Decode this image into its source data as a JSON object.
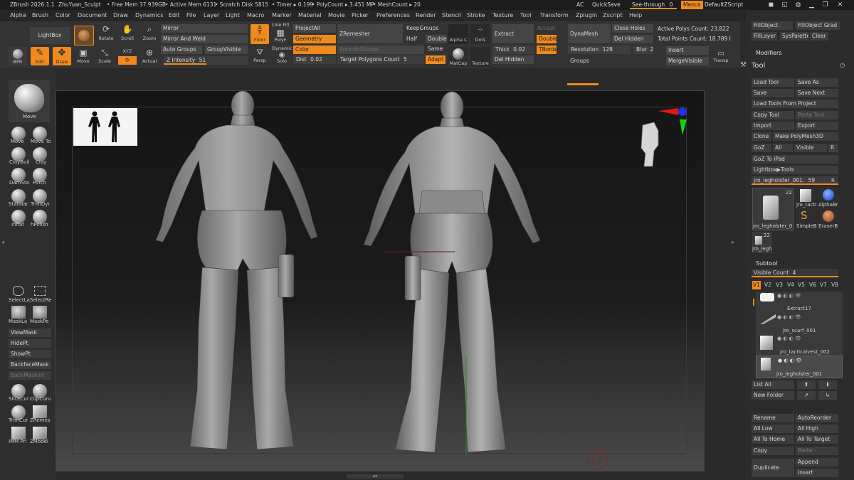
{
  "titlebar": {
    "app": "ZBrush 2026.1.1",
    "project": "ZhuYuan_Sculpt",
    "free_mem": "• Free Mem 37.939GB",
    "active_mem": "• Active Mem 6131",
    "scratch": "• Scratch Disk 5815",
    "timer": "• Timer ▸ 0.199",
    "polycount": "• PolyCount ▸ 3.451 MP",
    "meshcount": "• MeshCount ▸ 20",
    "ac": "AC",
    "quicksave": "QuickSave",
    "see_through": "See-through",
    "see_through_val": "0",
    "menus": "Menus",
    "script": "DefaultZScript"
  },
  "menus": [
    "Alpha",
    "Brush",
    "Color",
    "Document",
    "Draw",
    "Dynamics",
    "Edit",
    "File",
    "Layer",
    "Light",
    "Macro",
    "Marker",
    "Material",
    "Movie",
    "Picker",
    "Preferences",
    "Render",
    "Stencil",
    "Stroke",
    "Texture",
    "Tool",
    "Transform",
    "Zplugin",
    "Zscript",
    "Help"
  ],
  "toolbar": {
    "lightbox": "LightBox",
    "rotate": "Rotate",
    "scroll": "Scroll",
    "zoom": "Zoom",
    "bpr": "BPR",
    "edit": "Edit",
    "draw": "Draw",
    "move": "Move",
    "scale": "Scale",
    "xyz": "XYZ",
    "actual": "Actual",
    "mirror": "Mirror",
    "mirror_weld": "Mirror And Weld",
    "auto_groups": "Auto Groups",
    "group_visible": "GroupVisible",
    "z_intensity": "Z Intensity",
    "z_intensity_val": "51",
    "z_intensity_frac": 0.51,
    "floor": "Floor",
    "line_fill": "Line Fill",
    "polyf": "PolyF",
    "persp": "Persp",
    "dynamic": "Dynamic",
    "solo": "Solo",
    "projectall": "ProjectAll",
    "geometry": "Geometry",
    "color": "Color",
    "dist": "Dist",
    "dist_val": "0.02",
    "zremesher": "ZRemesher",
    "smoothgroups": "SmoothGroups",
    "target_polygons": "Target Polygons Count",
    "target_polygons_val": "5",
    "keepgroups": "KeepGroups",
    "half": "Half",
    "same": "Same",
    "adapt": "Adapt",
    "double": "Double",
    "alpha_c": "Alpha C",
    "matcap": "MatCap",
    "dots": "Dots",
    "texture": "Texture",
    "extract": "Extract",
    "thick": "Thick",
    "thick_val": "0.02",
    "del_hidden": "Del Hidden",
    "accept": "Accept",
    "double2": "Double",
    "tborder": "TBorde",
    "dynamesh": "DynaMesh",
    "close_holes": "Close Holes",
    "del_hidden2": "Del Hidden",
    "resolution": "Resolution",
    "resolution_val": "128",
    "blur": "Blur",
    "blur_val": "2",
    "groups": "Groups",
    "active_polys": "Active Polys Count: 23,822",
    "total_points": "Total Points Count: 18.789 I",
    "insert": "Insert",
    "merge_visible": "MergeVisible",
    "transp": "Transp"
  },
  "left": {
    "current_brush": "Move",
    "brushes": [
      "Move",
      "Move To",
      "ClayBuil",
      "Clay",
      "DamSta",
      "Pinch",
      "Standar",
      "TrimDyr",
      "Inflat",
      "hPolish"
    ],
    "select": [
      "SelectLa",
      "SelectRe"
    ],
    "mask": [
      "MaskLa",
      "MaskPe"
    ],
    "buttons": [
      "ViewMask",
      "HidePt",
      "ShowPt",
      "BackfaceMask",
      "BackMaskInt"
    ],
    "tools": [
      "SliceCur",
      "ClipCurv",
      "TrimCur",
      "ZRemes",
      "IMM Pri",
      "ZModel"
    ]
  },
  "right": {
    "fillobject": "FillObject",
    "fillobject_grad": "FillObject Grad",
    "filllayer": "FillLayer",
    "syspalette": "SysPalette",
    "clear": "Clear",
    "modifiers": "Modifiers",
    "tool_title": "Tool",
    "load_tool": "Load Tool",
    "save_as": "Save As",
    "save": "Save",
    "save_next": "Save Next",
    "load_from_project": "Load Tools From Project",
    "copy_tool": "Copy Tool",
    "paste_tool": "Paste Tool",
    "import": "Import",
    "export": "Export",
    "clone": "Clone",
    "make_polymesh": "Make PolyMesh3D",
    "goz": "GoZ",
    "all": "All",
    "visible": "Visible",
    "r": "R",
    "goz_ipad": "GoZ To iPad",
    "lightbox_tools": "Lightbox▶Tools",
    "current_tool": "jro_legholster_001.",
    "current_tool_val": "59",
    "thumb_count": "22",
    "thumbs": [
      "jro_legholster_0",
      "jro_tacti",
      "AlphaBr",
      "SimpleB",
      "EraserB"
    ],
    "small_thumb": "jro_legh",
    "small_count": "22",
    "subtool": "Subtool",
    "visible_count": "Visible Count",
    "visible_count_val": "4",
    "versions": [
      "V1",
      "V2",
      "V3",
      "V4",
      "V5",
      "V6",
      "V7",
      "V8"
    ],
    "subtools": [
      "Extract17",
      "jro_scarf_001",
      "jro_tacticalvest_002",
      "jro_legholster_001"
    ],
    "list_all": "List All",
    "new_folder": "New Folder",
    "rename": "Rename",
    "autoreorder": "AutoReorder",
    "all_low": "All Low",
    "all_high": "All High",
    "all_to_home": "All To Home",
    "all_to_target": "All To Target",
    "copy": "Copy",
    "paste": "Paste",
    "append": "Append",
    "duplicate": "Duplicate",
    "insert": "Insert"
  },
  "colors": {
    "accent": "#f08a1c",
    "background": "#2a2a2a",
    "viewport": "#101010"
  }
}
